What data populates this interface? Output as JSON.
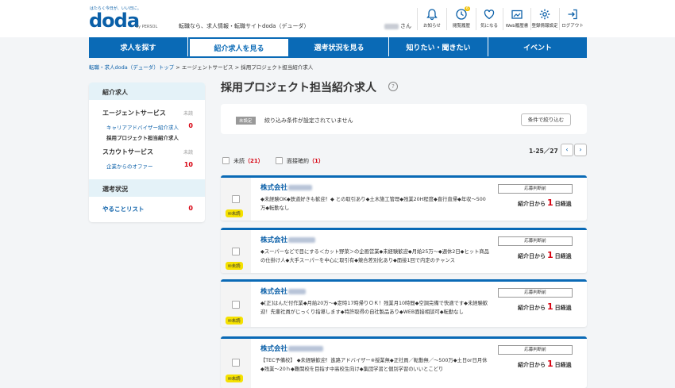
{
  "header": {
    "tagline": "はたらく今日が、いい日に。",
    "logo": "doda",
    "logo_sub": "by PERSOL",
    "site_desc": "転職なら、求人情報・転職サイトdoda（デューダ）",
    "user_suffix": "さん",
    "icons": [
      {
        "name": "bell-icon",
        "label": "お知らせ"
      },
      {
        "name": "clock-icon",
        "label": "閲覧履歴",
        "badge": "6"
      },
      {
        "name": "heart-icon",
        "label": "気になる"
      },
      {
        "name": "web-history-icon",
        "label": "Web履歴書"
      },
      {
        "name": "gear-icon",
        "label": "登録情報設定"
      },
      {
        "name": "logout-icon",
        "label": "ログアウト"
      }
    ]
  },
  "nav": {
    "items": [
      {
        "label": "求人を探す",
        "active": false
      },
      {
        "label": "紹介求人を見る",
        "active": true
      },
      {
        "label": "選考状況を見る",
        "active": false
      },
      {
        "label": "知りたい・聞きたい",
        "active": false
      },
      {
        "label": "イベント",
        "active": false
      }
    ]
  },
  "breadcrumb": {
    "items": [
      "転職・求人doda（デューダ）トップ",
      "エージェントサービス",
      "採用プロジェクト担当紹介求人"
    ],
    "sep": " > "
  },
  "sidebar": {
    "head": "紹介求人",
    "agent_title": "エージェントサービス",
    "agent_stat": "未読",
    "advisor_link": "キャリアアドバイザー紹介求人",
    "advisor_count": "0",
    "project_current": "採用プロジェクト担当紹介求人",
    "scout_title": "スカウトサービス",
    "scout_stat": "未読",
    "offer_link": "企業からのオファー",
    "offer_count": "10",
    "status_head": "選考状況",
    "todo_link": "やることリスト",
    "todo_count": "0"
  },
  "main": {
    "title": "採用プロジェクト担当紹介求人",
    "help": "?",
    "filter_tag": "未設定",
    "filter_text": "絞り込み条件が設定されていません",
    "filter_button": "条件で絞り込む",
    "paging": "1-25／27",
    "prev": "‹",
    "next": "›",
    "unread_label": "未読",
    "unread_count": "（21）",
    "interview_label": "面接確約",
    "interview_count": "（1）"
  },
  "cards": [
    {
      "company_prefix": "株式会社",
      "desc": "◆未経験OK◆鉄道好きも歓迎！◆ との取引あり◆土木施工管理◆残業20H程度◆直行直帰◆年収～500万◆転勤なし",
      "status": "応募判断前",
      "elapsed_pre": "紹介日から",
      "elapsed_num": "1",
      "elapsed_post": "日経過",
      "badge": "未読"
    },
    {
      "company_prefix": "株式会社",
      "desc": "◆スーパーなどで目にする＜カット野菜＞の企画営業◆未経験歓迎◆月給25万～◆週休2日◆ヒット商品の仕掛け人◆大手スーパーを中心に取引有◆競合差別化あり◆面接1回で内定のチャンス",
      "status": "応募判断前",
      "elapsed_pre": "紹介日から",
      "elapsed_num": "1",
      "elapsed_post": "日経過",
      "badge": "未読"
    },
    {
      "company_prefix": "株式会社",
      "desc": "◆[正]はんだ付作業◆月給20万～◆定時17時帰りＯＫ！残業月10時間◆空調完備で快適です◆未経験歓迎！先輩社員がじっくり指導します◆特許取得の自社製品あり◆WEB面接相談可◆転勤なし",
      "status": "応募判断前",
      "elapsed_pre": "紹介日から",
      "elapsed_num": "1",
      "elapsed_post": "日経過",
      "badge": "未読"
    },
    {
      "company_prefix": "株式会社",
      "desc": "【TEC予備校】 ◆未経験歓迎！進路アドバイザー※授業無◆正社員／転勤無／～500万◆土日or日月休◆残業～20ｈ◆難関校を目指す中高校生向け◆集団学習と個別学習のいいとこどり",
      "status": "応募判断前",
      "elapsed_pre": "紹介日から",
      "elapsed_num": "1",
      "elapsed_post": "日経過",
      "badge": "未読"
    }
  ]
}
